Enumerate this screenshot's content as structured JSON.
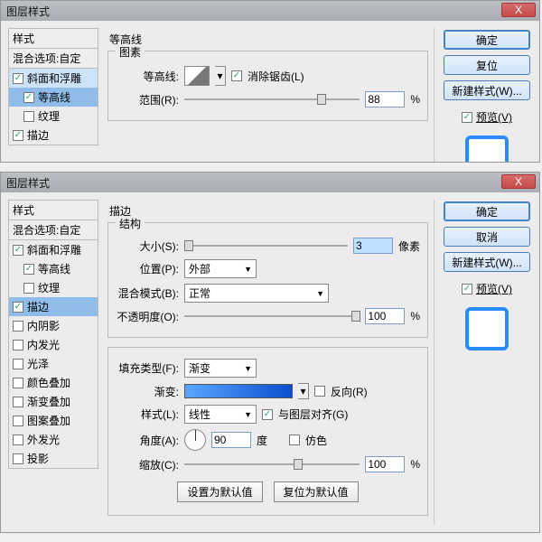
{
  "window_title": "图层样式",
  "close_x": "X",
  "styles_header": "样式",
  "blend_options": "混合选项:自定",
  "top": {
    "style_items": [
      {
        "label": "斜面和浮雕",
        "checked": true,
        "indent": false,
        "sel": "selected"
      },
      {
        "label": "等高线",
        "checked": true,
        "indent": true,
        "sel": "active"
      },
      {
        "label": "纹理",
        "checked": false,
        "indent": true,
        "sel": ""
      },
      {
        "label": "描边",
        "checked": true,
        "indent": false,
        "sel": ""
      }
    ],
    "panel_title": "等高线",
    "group_title": "图素",
    "contour_label": "等高线:",
    "antialias": "消除锯齿(L)",
    "range_label": "范围(R):",
    "range_value": "88",
    "percent": "%",
    "buttons": {
      "ok": "确定",
      "reset": "复位",
      "newstyle": "新建样式(W)..."
    },
    "preview_label": "预览(V)"
  },
  "bottom": {
    "style_items": [
      {
        "label": "斜面和浮雕",
        "checked": true,
        "indent": false,
        "sel": ""
      },
      {
        "label": "等高线",
        "checked": true,
        "indent": true,
        "sel": ""
      },
      {
        "label": "纹理",
        "checked": false,
        "indent": true,
        "sel": ""
      },
      {
        "label": "描边",
        "checked": true,
        "indent": false,
        "sel": "active"
      },
      {
        "label": "内阴影",
        "checked": false,
        "indent": false,
        "sel": ""
      },
      {
        "label": "内发光",
        "checked": false,
        "indent": false,
        "sel": ""
      },
      {
        "label": "光泽",
        "checked": false,
        "indent": false,
        "sel": ""
      },
      {
        "label": "颜色叠加",
        "checked": false,
        "indent": false,
        "sel": ""
      },
      {
        "label": "渐变叠加",
        "checked": false,
        "indent": false,
        "sel": ""
      },
      {
        "label": "图案叠加",
        "checked": false,
        "indent": false,
        "sel": ""
      },
      {
        "label": "外发光",
        "checked": false,
        "indent": false,
        "sel": ""
      },
      {
        "label": "投影",
        "checked": false,
        "indent": false,
        "sel": ""
      }
    ],
    "panel_title": "描边",
    "group1_title": "结构",
    "size_label": "大小(S):",
    "size_value": "3",
    "size_unit": "像素",
    "position_label": "位置(P):",
    "position_value": "外部",
    "blend_label": "混合模式(B):",
    "blend_value": "正常",
    "opacity_label": "不透明度(O):",
    "opacity_value": "100",
    "percent": "%",
    "filltype_label": "填充类型(F):",
    "filltype_value": "渐变",
    "grad_label": "渐变:",
    "reverse": "反向(R)",
    "style_label": "样式(L):",
    "style_value": "线性",
    "align_layer": "与图层对齐(G)",
    "angle_label": "角度(A):",
    "angle_value": "90",
    "angle_unit": "度",
    "dither": "仿色",
    "scale_label": "缩放(C):",
    "scale_value": "100",
    "btn_default": "设置为默认值",
    "btn_reset_default": "复位为默认值",
    "buttons": {
      "ok": "确定",
      "cancel": "取消",
      "newstyle": "新建样式(W)..."
    },
    "preview_label": "预览(V)"
  }
}
